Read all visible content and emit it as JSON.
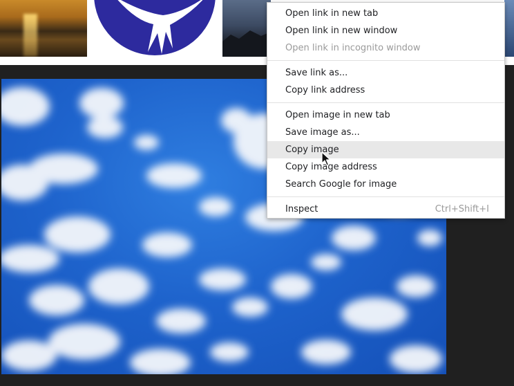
{
  "context_menu": {
    "items": [
      {
        "label": "Open link in new tab"
      },
      {
        "label": "Open link in new window"
      },
      {
        "label": "Open link in incognito window",
        "disabled": true
      },
      {
        "label": "Save link as..."
      },
      {
        "label": "Copy link address"
      },
      {
        "label": "Open image in new tab"
      },
      {
        "label": "Save image as..."
      },
      {
        "label": "Copy image",
        "highlighted": true
      },
      {
        "label": "Copy image address"
      },
      {
        "label": "Search Google for image"
      },
      {
        "label": "Inspect",
        "shortcut": "Ctrl+Shift+I"
      }
    ]
  },
  "thumbnails": [
    {
      "name": "sunset-thumbnail"
    },
    {
      "name": "bird-logo-thumbnail"
    },
    {
      "name": "mountain-thumbnail"
    }
  ],
  "colors": {
    "sky_blue": "#1e63cc",
    "logo_blue": "#2d2a9e",
    "menu_highlight": "#e8e8e8",
    "disabled_text": "#9a9a9a"
  },
  "icons": {
    "cursor": "mouse-pointer-icon"
  }
}
